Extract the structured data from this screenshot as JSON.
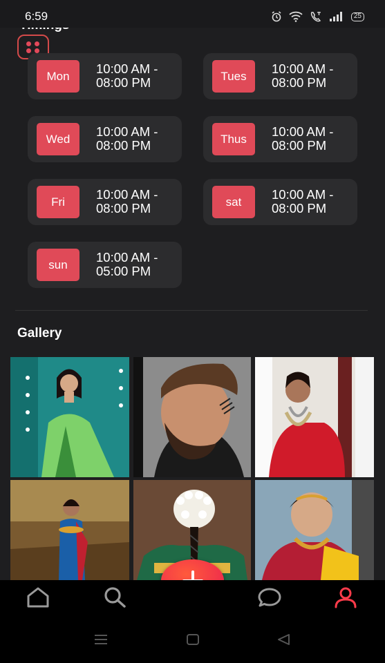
{
  "status_bar": {
    "time": "6:59",
    "battery": "25"
  },
  "timings": {
    "title": "Timings",
    "days": [
      {
        "day": "Mon",
        "hours_line1": "10:00 AM -",
        "hours_line2": "08:00 PM"
      },
      {
        "day": "Tues",
        "hours_line1": "10:00 AM -",
        "hours_line2": "08:00 PM"
      },
      {
        "day": "Wed",
        "hours_line1": "10:00 AM -",
        "hours_line2": "08:00 PM"
      },
      {
        "day": "Thus",
        "hours_line1": "10:00 AM -",
        "hours_line2": "08:00 PM"
      },
      {
        "day": "Fri",
        "hours_line1": "10:00 AM -",
        "hours_line2": "08:00 PM"
      },
      {
        "day": "sat",
        "hours_line1": "10:00 AM -",
        "hours_line2": "08:00 PM"
      },
      {
        "day": "sun",
        "hours_line1": "10:00 AM -",
        "hours_line2": "05:00 PM"
      }
    ]
  },
  "gallery": {
    "title": "Gallery"
  },
  "colors": {
    "accent": "#e04a58",
    "card_bg": "#2c2c2e",
    "page_bg": "#1e1e20",
    "active_nav": "#ff3b4a"
  },
  "nav": {
    "items": [
      "home-icon",
      "search-icon",
      "add-icon",
      "chat-icon",
      "profile-icon"
    ],
    "active": "profile-icon"
  }
}
